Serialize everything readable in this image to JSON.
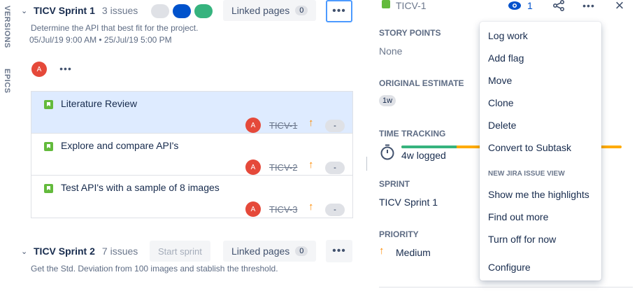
{
  "side_tabs": {
    "versions": "VERSIONS",
    "epics": "EPICS"
  },
  "sprint1": {
    "name": "TICV Sprint 1",
    "issue_count": "3 issues",
    "linked_pages_label": "Linked pages",
    "linked_pages_count": "0",
    "description": "Determine the API that best fit for the project.",
    "dates": "05/Jul/19 9:00 AM • 25/Jul/19 5:00 PM",
    "status_colors": [
      "#DFE1E6",
      "#0052CC",
      "#36B37E"
    ]
  },
  "assignee_filter": {
    "avatar_initial": "A",
    "avatar_color": "#E5493A"
  },
  "issues": [
    {
      "title": "Literature Review",
      "key": "TICV-1",
      "avatar": "A",
      "estimate": "-",
      "selected": true
    },
    {
      "title": "Explore and compare API's",
      "key": "TICV-2",
      "avatar": "A",
      "estimate": "-",
      "selected": false
    },
    {
      "title": "Test API's with a sample of 8 images",
      "key": "TICV-3",
      "avatar": "A",
      "estimate": "-",
      "selected": false
    }
  ],
  "sprint2": {
    "name": "TICV Sprint 2",
    "issue_count": "7 issues",
    "start_label": "Start sprint",
    "linked_pages_label": "Linked pages",
    "linked_pages_count": "0",
    "description": "Get the Std. Deviation from 100 images and stablish the threshold."
  },
  "detail": {
    "key": "TICV-1",
    "watchers": "1",
    "story_points_label": "STORY POINTS",
    "story_points_value": "None",
    "original_estimate_label": "ORIGINAL ESTIMATE",
    "original_estimate_value": "1w",
    "time_tracking_label": "TIME TRACKING",
    "time_tracking_value": "4w logged",
    "time_tracking_logged_fraction": 0.25,
    "sprint_label": "SPRINT",
    "sprint_value": "TICV Sprint 1",
    "priority_label": "PRIORITY",
    "priority_value": "Medium"
  },
  "menu": {
    "items": [
      "Log work",
      "Add flag",
      "Move",
      "Clone",
      "Delete",
      "Convert to Subtask"
    ],
    "section_title": "NEW JIRA ISSUE VIEW",
    "section_items": [
      "Show me the highlights",
      "Find out more",
      "Turn off for now"
    ],
    "configure": "Configure"
  },
  "icons": [
    "chevron-down-icon",
    "more-icon",
    "eye-icon",
    "share-icon",
    "close-icon",
    "stopwatch-icon",
    "arrow-up-icon",
    "story-icon"
  ]
}
